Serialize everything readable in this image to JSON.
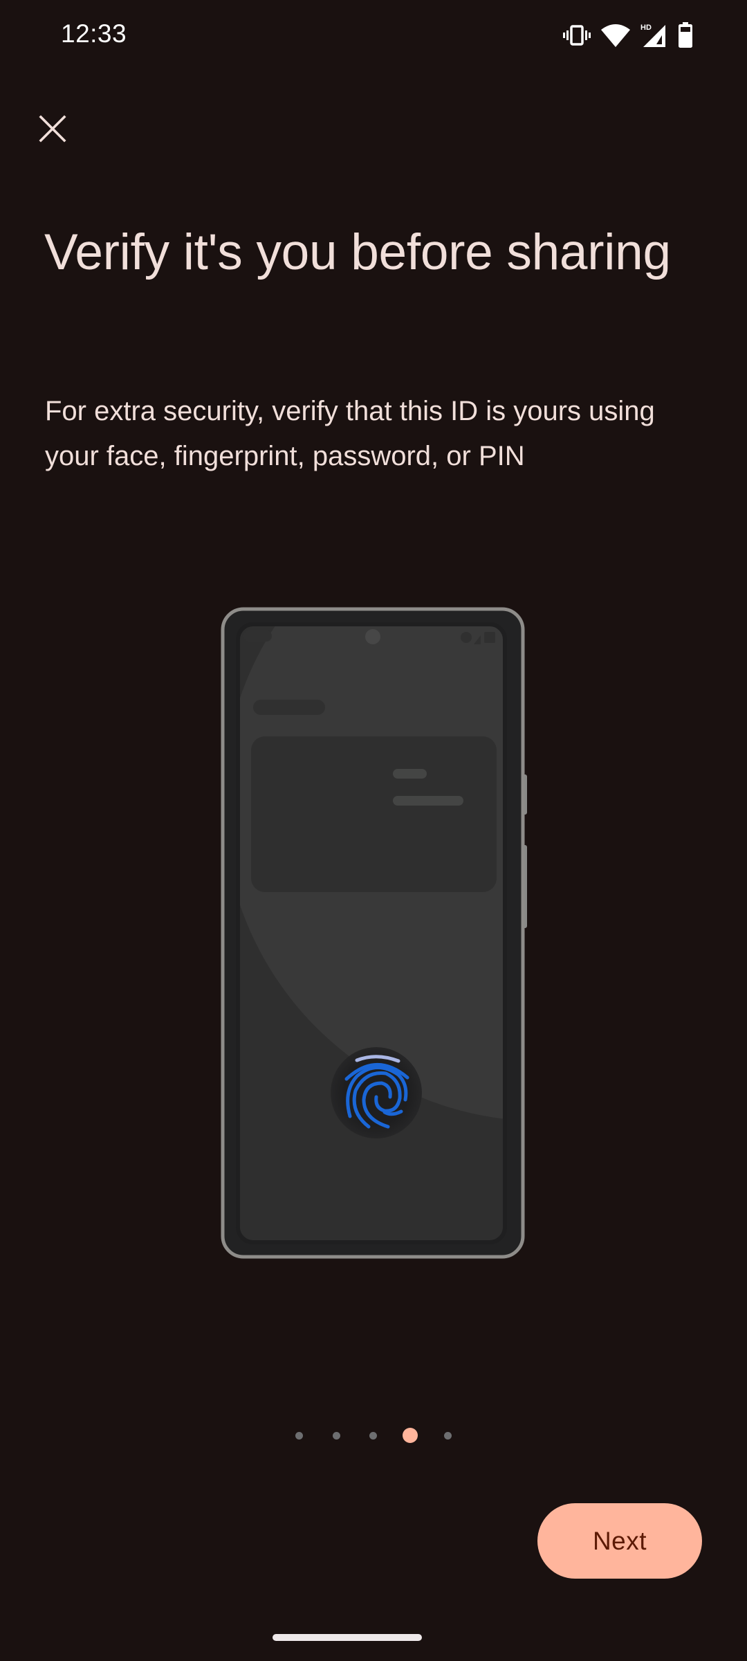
{
  "status_bar": {
    "time": "12:33",
    "icons": [
      "vibrate-icon",
      "wifi-icon",
      "cellular-signal-icon",
      "battery-icon"
    ],
    "network_badge": "HD"
  },
  "header": {
    "close_icon": "close-icon"
  },
  "content": {
    "title": "Verify it's you before sharing",
    "description": "For extra security, verify that this ID is yours using your face, fingerprint, password, or PIN",
    "illustration": "phone-with-fingerprint-sensor"
  },
  "pager": {
    "total_pages": 5,
    "current_page": 4
  },
  "footer": {
    "next_label": "Next"
  },
  "colors": {
    "background": "#1a1110",
    "accent": "#ffb59c",
    "accent_text": "#5c1a05",
    "text": "#f1dfda",
    "fingerprint": "#1a66d6"
  }
}
